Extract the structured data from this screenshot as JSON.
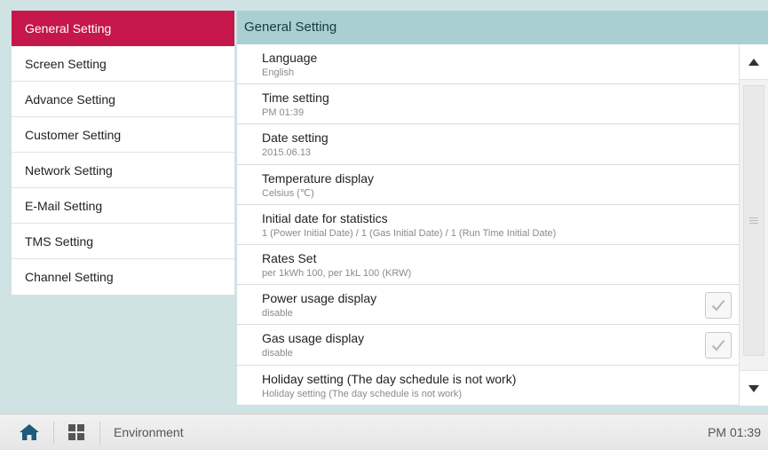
{
  "sidebar": {
    "items": [
      {
        "label": "General Setting"
      },
      {
        "label": "Screen Setting"
      },
      {
        "label": "Advance Setting"
      },
      {
        "label": "Customer Setting"
      },
      {
        "label": "Network Setting"
      },
      {
        "label": "E-Mail Setting"
      },
      {
        "label": "TMS Setting"
      },
      {
        "label": "Channel Setting"
      }
    ]
  },
  "main": {
    "title": "General Setting",
    "rows": [
      {
        "title": "Language",
        "value": "English"
      },
      {
        "title": "Time setting",
        "value": "PM 01:39"
      },
      {
        "title": "Date setting",
        "value": "2015.06.13"
      },
      {
        "title": "Temperature display",
        "value": "Celsius (℃)"
      },
      {
        "title": "Initial date for statistics",
        "value": "1 (Power Initial Date) / 1 (Gas Initial Date) / 1 (Run Time Initial Date)"
      },
      {
        "title": "Rates Set",
        "value": "per 1kWh 100, per 1kL 100 (KRW)"
      },
      {
        "title": "Power usage display",
        "value": "disable"
      },
      {
        "title": "Gas usage display",
        "value": "disable"
      },
      {
        "title": "Holiday setting (The day schedule is not work)",
        "value": "Holiday setting (The day schedule is not work)"
      }
    ]
  },
  "bottom": {
    "breadcrumb": "Environment",
    "clock": "PM 01:39"
  },
  "colors": {
    "accent": "#c5174a",
    "header": "#a9cfd3",
    "background": "#cfe2e4"
  }
}
